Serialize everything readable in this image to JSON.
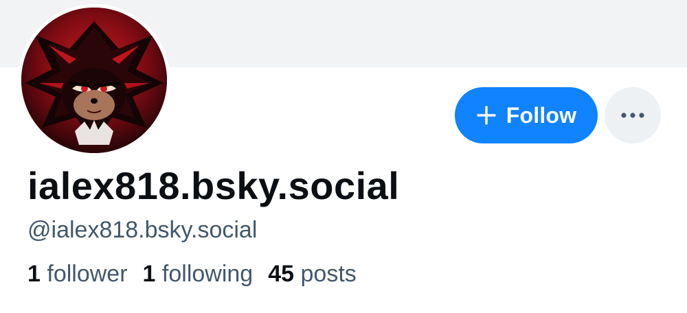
{
  "profile": {
    "display_name": "ialex818.bsky.social",
    "handle": "@ialex818.bsky.social",
    "avatar_icon": "hedgehog-avatar"
  },
  "actions": {
    "follow_label": "Follow",
    "follow_icon": "plus-icon",
    "more_icon": "ellipsis-icon"
  },
  "stats": {
    "followers_count": "1",
    "followers_label": "follower",
    "following_count": "1",
    "following_label": "following",
    "posts_count": "45",
    "posts_label": "posts"
  },
  "colors": {
    "accent": "#1083fe",
    "banner": "#f1f3f5",
    "text_primary": "#0b0f14",
    "text_secondary": "#42576c"
  }
}
